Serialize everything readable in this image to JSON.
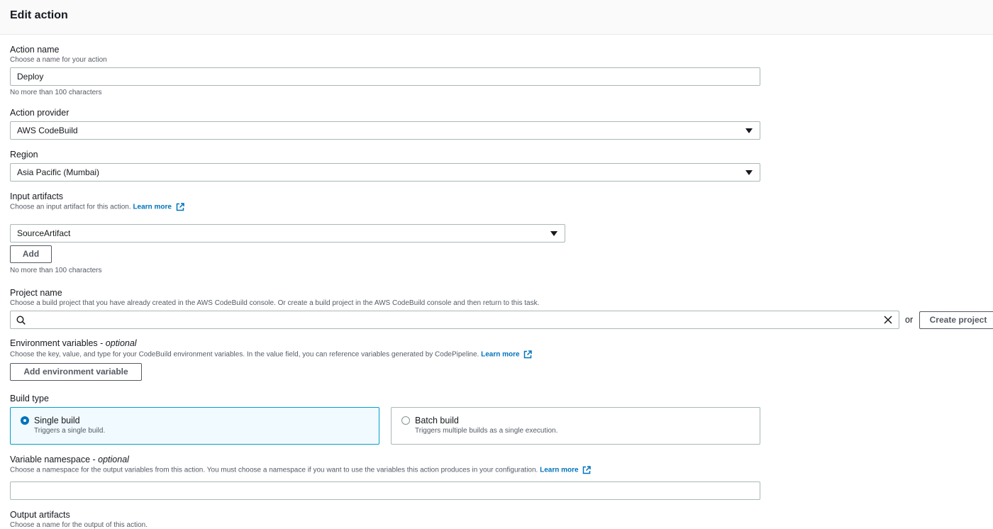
{
  "header": {
    "title": "Edit action"
  },
  "action_name": {
    "label": "Action name",
    "description": "Choose a name for your action",
    "value": "Deploy",
    "constraint": "No more than 100 characters"
  },
  "action_provider": {
    "label": "Action provider",
    "value": "AWS CodeBuild"
  },
  "region": {
    "label": "Region",
    "value": "Asia Pacific (Mumbai)"
  },
  "input_artifacts": {
    "label": "Input artifacts",
    "description": "Choose an input artifact for this action.",
    "link": "Learn more",
    "value": "SourceArtifact",
    "add_button": "Add",
    "constraint": "No more than 100 characters"
  },
  "project_name": {
    "label": "Project name",
    "description": "Choose a build project that you have already created in the AWS CodeBuild console. Or create a build project in the AWS CodeBuild console and then return to this task.",
    "search_value": "",
    "or_text": "or",
    "create_button": "Create project"
  },
  "env_vars": {
    "label": "Environment variables -",
    "optional": "optional",
    "description": "Choose the key, value, and type for your CodeBuild environment variables. In the value field, you can reference variables generated by CodePipeline.",
    "link": "Learn more",
    "add_button": "Add environment variable"
  },
  "build_type": {
    "label": "Build type",
    "options": [
      {
        "title": "Single build",
        "description": "Triggers a single build.",
        "selected": true
      },
      {
        "title": "Batch build",
        "description": "Triggers multiple builds as a single execution.",
        "selected": false
      }
    ]
  },
  "variable_namespace": {
    "label": "Variable namespace -",
    "optional": "optional",
    "description": "Choose a namespace for the output variables from this action. You must choose a namespace if you want to use the variables this action produces in your configuration.",
    "link": "Learn more",
    "value": ""
  },
  "output_artifacts": {
    "label": "Output artifacts",
    "description": "Choose a name for the output of this action."
  },
  "colors": {
    "link": "#0073bb",
    "selected_border": "#00a1c9",
    "selected_bg": "#f1faff",
    "text": "#16191f",
    "muted": "#545b64"
  }
}
